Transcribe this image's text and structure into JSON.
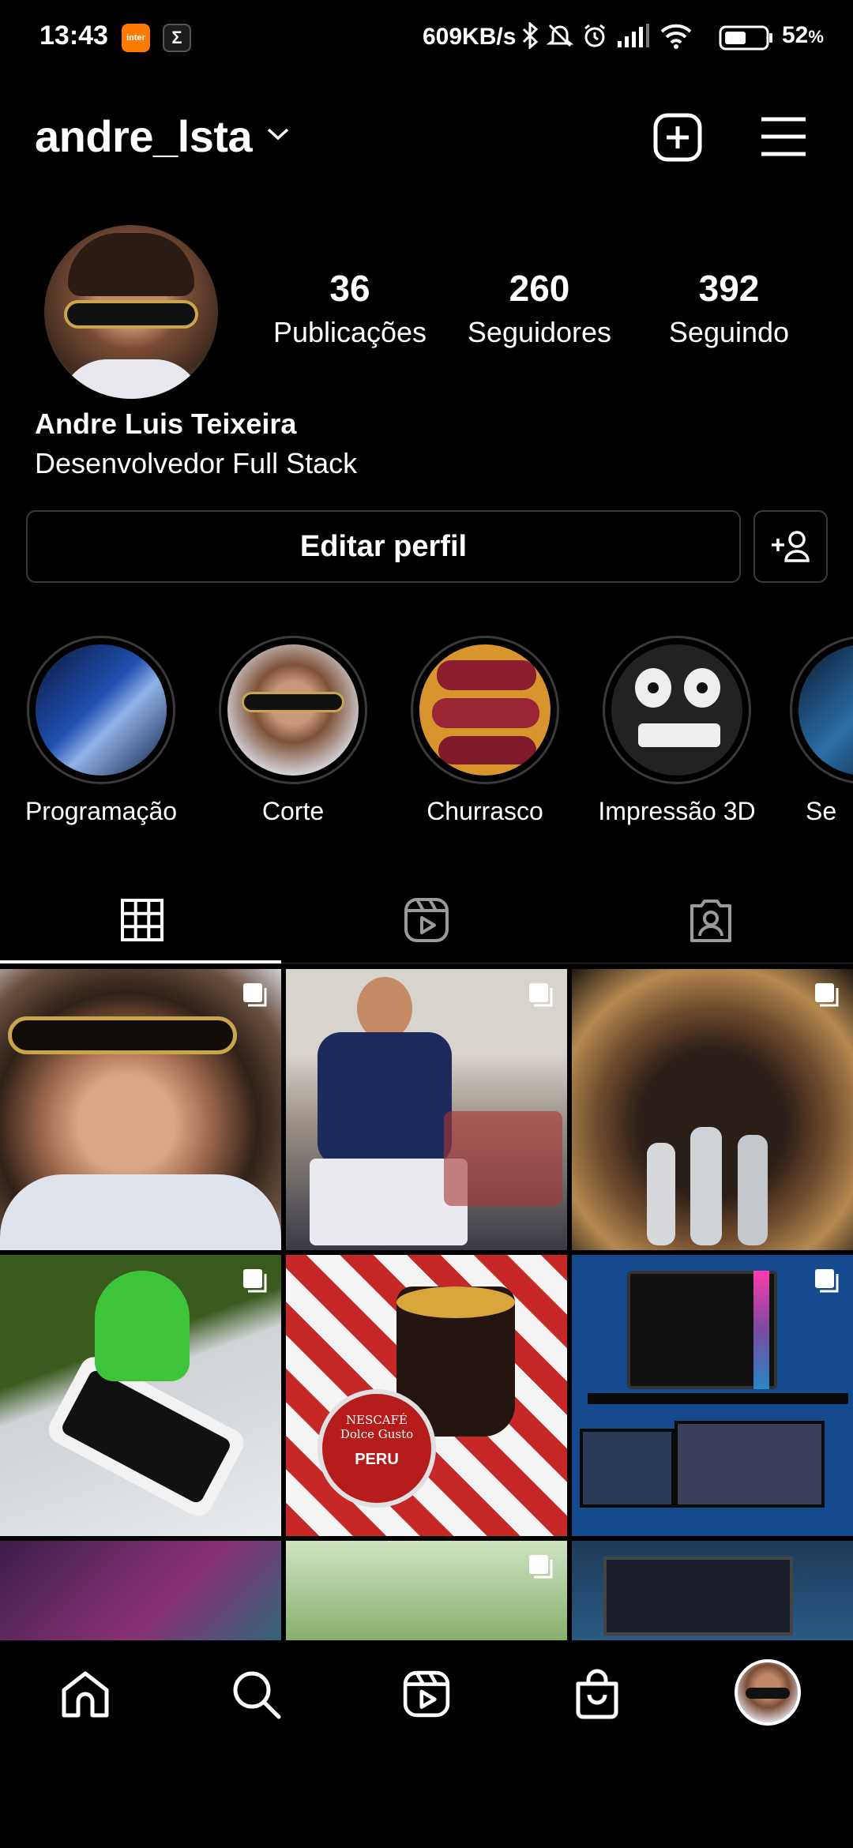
{
  "status_bar": {
    "time": "13:43",
    "app_icon_1": "inter",
    "app_icon_2": "Σ",
    "network_speed": "609KB/s",
    "battery_percent": "52",
    "battery_unit": "%",
    "icons": [
      "bluetooth-icon",
      "mute-bell-icon",
      "alarm-icon",
      "signal-icon",
      "wifi-icon",
      "battery-icon"
    ]
  },
  "header": {
    "username": "andre_lsta",
    "icons": [
      "chevron-down-icon",
      "new-post-icon",
      "menu-icon"
    ]
  },
  "profile": {
    "stats": [
      {
        "value": "36",
        "label": "Publicações"
      },
      {
        "value": "260",
        "label": "Seguidores"
      },
      {
        "value": "392",
        "label": "Seguindo"
      }
    ],
    "full_name": "Andre Luis Teixeira",
    "bio": "Desenvolvedor Full Stack",
    "edit_button": "Editar perfil"
  },
  "highlights": [
    {
      "label": "Programação"
    },
    {
      "label": "Corte"
    },
    {
      "label": "Churrasco"
    },
    {
      "label": "Impressão 3D"
    },
    {
      "label": "Se"
    }
  ],
  "tabs": [
    "grid-icon",
    "reels-icon",
    "tagged-icon"
  ],
  "posts_grid": {
    "tiles": [
      {
        "subject": "selfie with sunglasses",
        "multi": true
      },
      {
        "subject": "man cutting birthday cake",
        "multi": true
      },
      {
        "subject": "grilled steak on board",
        "multi": true
      },
      {
        "subject": "3D printed android on phone",
        "multi": true
      },
      {
        "subject": "cup of coffee with Nescafé Dolce Gusto capsule",
        "multi": false
      },
      {
        "subject": "desktop PC setup",
        "multi": true
      },
      {
        "subject": "umbrellas",
        "multi": false
      },
      {
        "subject": "plant",
        "multi": true
      },
      {
        "subject": "monitor setup",
        "multi": false
      }
    ],
    "capsule_brand": "NESCAFÉ Dolce Gusto",
    "capsule_flavor": "PERU"
  },
  "bottom_nav": [
    "home-icon",
    "search-icon",
    "reels-icon",
    "shop-icon",
    "profile-avatar"
  ],
  "colors": {
    "background": "#000000",
    "text": "#ffffff",
    "border": "#3a3a3a"
  }
}
